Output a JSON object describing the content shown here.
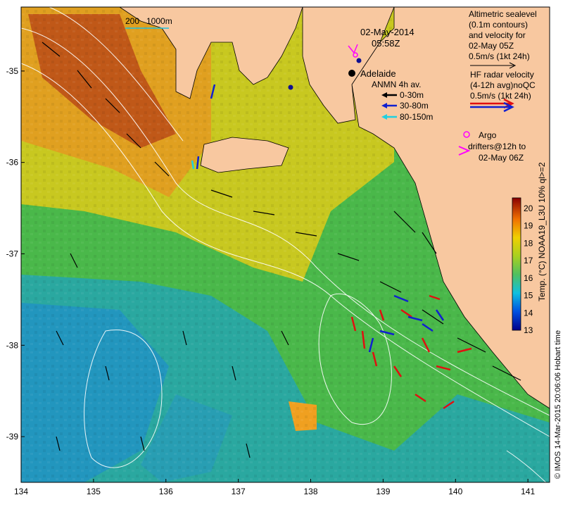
{
  "title": {
    "date": "02-May-2014",
    "time": "05:58Z"
  },
  "scale_bar": {
    "label": "200",
    "label_units": "1000m"
  },
  "city": "Adelaide",
  "altimetry_legend": {
    "lines": [
      "Altimetric sealevel",
      "(0.1m contours)",
      "and velocity for",
      "02-May 05Z",
      "0.5m/s (1kt 24h)"
    ]
  },
  "hf_radar_legend": {
    "lines": [
      "HF radar velocity",
      "(4-12h avg)noQC",
      "0.5m/s (1kt 24h)"
    ],
    "colors": [
      "#e01010",
      "#1020d0"
    ]
  },
  "anmn_legend": {
    "title": "ANMN 4h av.",
    "items": [
      {
        "label": "0-30m",
        "color": "#000000"
      },
      {
        "label": "30-80m",
        "color": "#1020d0"
      },
      {
        "label": "80-150m",
        "color": "#20d0e0"
      }
    ]
  },
  "argo_legend": {
    "lines": [
      "Argo",
      "drifters@12h to",
      "02-May 06Z"
    ],
    "color": "#ff00ff"
  },
  "colorbar": {
    "label": "Temp. (°C) NOAA19_L3U 10% ql>=2",
    "ticks": [
      "20",
      "19",
      "18",
      "17",
      "16",
      "15",
      "14",
      "13"
    ],
    "range": [
      13,
      20.6
    ]
  },
  "credit": "© IMOS 14-Mar-2015 20:06:06 Hobart time",
  "axes": {
    "x_ticks": [
      "134",
      "135",
      "136",
      "137",
      "138",
      "139",
      "140",
      "141"
    ],
    "y_ticks": [
      "-35",
      "-36",
      "-37",
      "-38",
      "-39"
    ],
    "lon_range": [
      134,
      141.3
    ],
    "lat_range": [
      -34.3,
      -39.5
    ]
  }
}
